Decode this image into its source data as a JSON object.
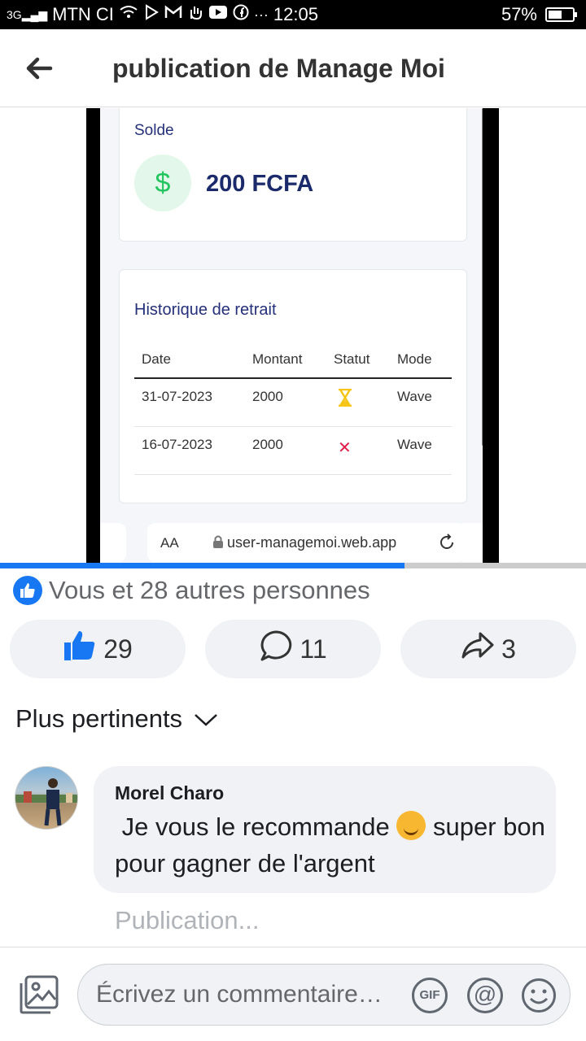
{
  "status_bar": {
    "network": "3G",
    "carrier": "MTN CI",
    "time": "12:05",
    "battery": "57%",
    "battery_level": 0.57
  },
  "header": {
    "title": "publication de Manage Moi"
  },
  "media": {
    "solde_label": "Solde",
    "solde_icon": "$",
    "solde_value": "200 FCFA",
    "history_title": "Historique de retrait",
    "columns": [
      "Date",
      "Montant",
      "Statut",
      "Mode"
    ],
    "rows": [
      {
        "date": "31-07-2023",
        "amount": "2000",
        "status": "pending",
        "mode": "Wave"
      },
      {
        "date": "16-07-2023",
        "amount": "2000",
        "status": "rejected",
        "mode": "Wave"
      }
    ],
    "status_reject_glyph": "✕",
    "url_aa": "AA",
    "url": "user-managemoi.web.app",
    "video_progress": 0.69
  },
  "reactions": {
    "summary": "Vous et 28 autres personnes"
  },
  "actions": {
    "likes": "29",
    "comments": "11",
    "shares": "3"
  },
  "sort": {
    "label": "Plus pertinents"
  },
  "comment": {
    "author": "Morel Charo",
    "text_before_emoji": "Je vous le recommande",
    "text_after_emoji": "super bon pour gagner de l'argent",
    "reply_placeholder": "Publication..."
  },
  "composer": {
    "placeholder": "Écrivez un commentaire…",
    "gif_label": "GIF",
    "at_label": "@"
  },
  "colors": {
    "facebook_blue": "#1877f2",
    "bubble_gray": "#f0f2f5",
    "solde_navy": "#1b2a6b",
    "pending_yellow": "#f5c518",
    "reject_red": "#e11d48"
  }
}
